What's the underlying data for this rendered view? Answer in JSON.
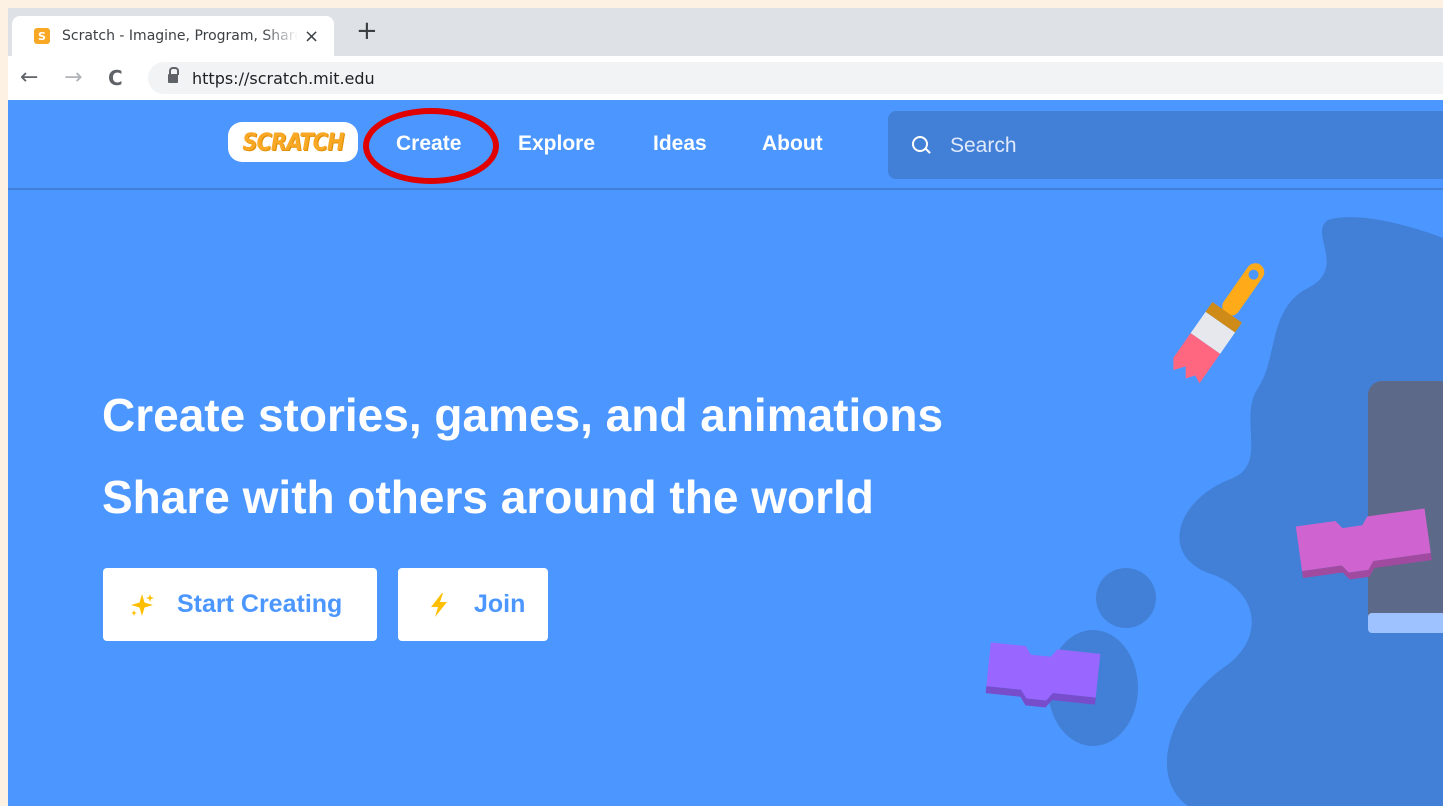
{
  "browser": {
    "tab_title": "Scratch - Imagine, Program, Share",
    "tab_favicon_letter": "S",
    "tab_close": "×",
    "new_tab": "+",
    "back": "←",
    "forward": "→",
    "reload": "C",
    "url": "https://scratch.mit.edu"
  },
  "navbar": {
    "logo_text": "SCRATCH",
    "links": [
      "Create",
      "Explore",
      "Ideas",
      "About"
    ],
    "search_placeholder": "Search"
  },
  "hero": {
    "line1": "Create stories, games, and animations",
    "line2": "Share with others around the world",
    "start_button": "Start Creating",
    "join_button": "Join"
  },
  "colors": {
    "brand_blue": "#4c97ff",
    "nav_dark_blue": "#4280d7",
    "annotation_red": "#e00000",
    "logo_orange": "#f9a825"
  },
  "icons": {
    "start_creating": "sparkle-icon",
    "join": "lightning-icon"
  }
}
